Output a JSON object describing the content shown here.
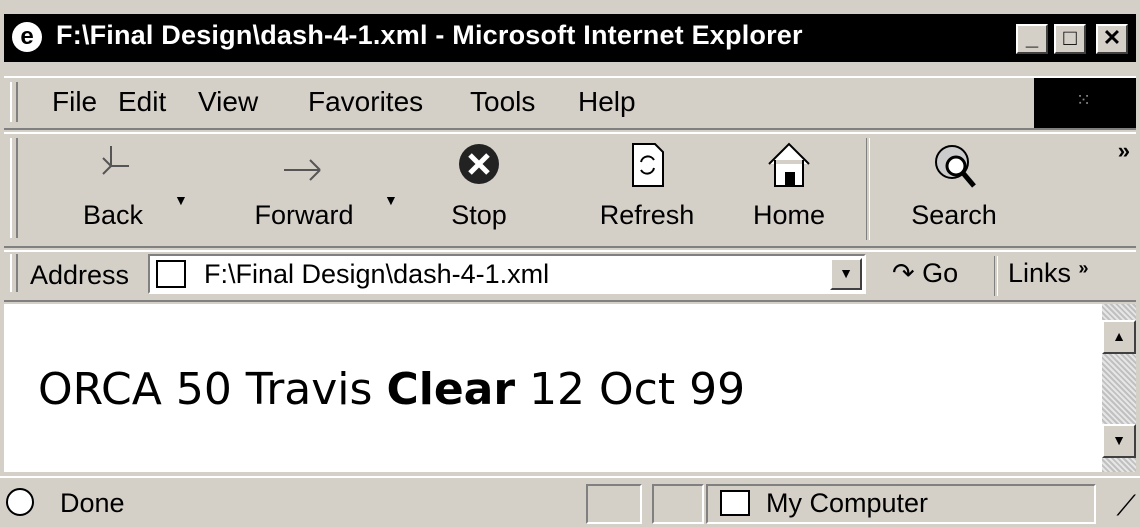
{
  "window": {
    "title": "F:\\Final Design\\dash-4-1.xml - Microsoft Internet Explorer",
    "controls": {
      "minimize": "_",
      "maximize": "□",
      "close": "✕"
    }
  },
  "menu": {
    "items": [
      "File",
      "Edit",
      "View",
      "Favorites",
      "Tools",
      "Help"
    ]
  },
  "toolbar": {
    "buttons": [
      {
        "label": "Back",
        "icon": "back-arrow-icon"
      },
      {
        "label": "Forward",
        "icon": "forward-arrow-icon"
      },
      {
        "label": "Stop",
        "icon": "stop-icon"
      },
      {
        "label": "Refresh",
        "icon": "refresh-icon"
      },
      {
        "label": "Home",
        "icon": "home-icon"
      },
      {
        "label": "Search",
        "icon": "search-icon"
      }
    ],
    "more": "»"
  },
  "address": {
    "label": "Address",
    "value": "F:\\Final Design\\dash-4-1.xml",
    "go_label": "Go",
    "links_label": "Links",
    "links_more": "»"
  },
  "content": {
    "prefix": "ORCA 50 Travis",
    "bold": "Clear",
    "suffix": "12 Oct 99"
  },
  "status": {
    "text": "Done",
    "zone": "My Computer"
  }
}
